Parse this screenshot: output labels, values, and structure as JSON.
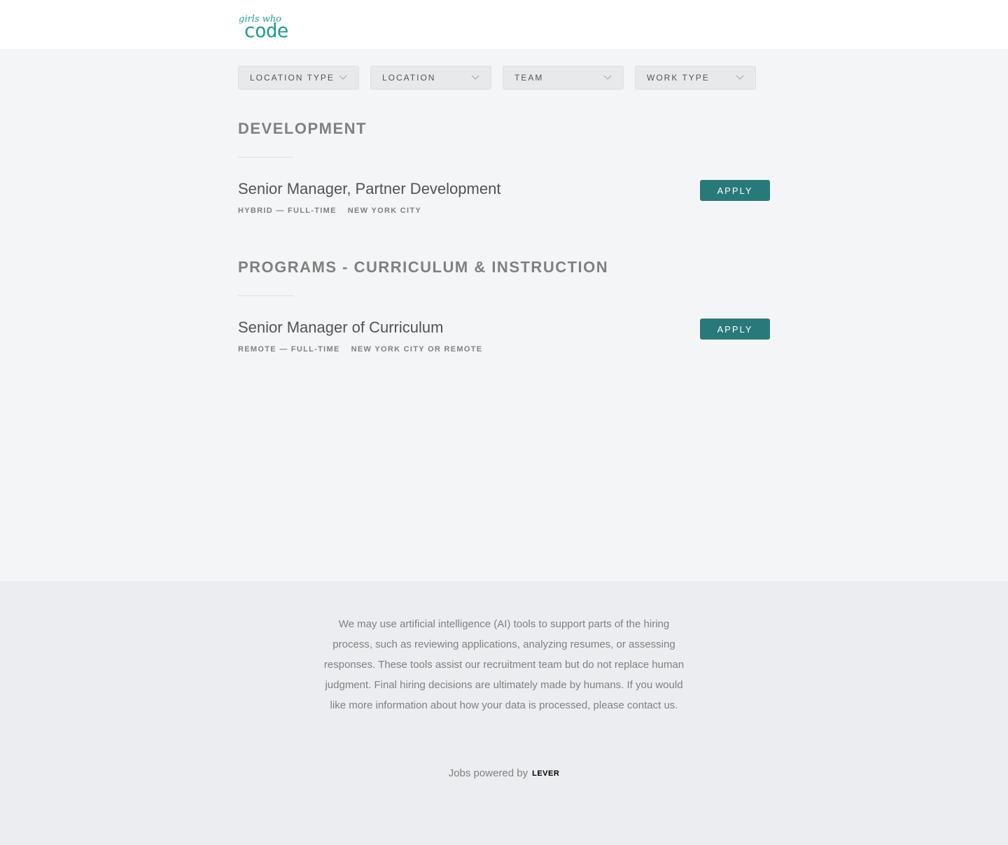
{
  "brand": {
    "logo_alt": "girls who code",
    "logo_top": "girls who",
    "logo_bottom": "code",
    "color": "#1f9e94"
  },
  "filters": [
    {
      "label": "LOCATION TYPE",
      "icon": "chevron-down-icon"
    },
    {
      "label": "LOCATION",
      "icon": "chevron-down-icon"
    },
    {
      "label": "TEAM",
      "icon": "chevron-down-icon"
    },
    {
      "label": "WORK TYPE",
      "icon": "chevron-down-icon"
    }
  ],
  "sections": [
    {
      "title": "DEVELOPMENT",
      "postings": [
        {
          "title": "Senior Manager, Partner Development",
          "commitment": "HYBRID — FULL-TIME",
          "location": "NEW YORK CITY",
          "apply_label": "APPLY"
        }
      ]
    },
    {
      "title": "PROGRAMS - CURRICULUM & INSTRUCTION",
      "postings": [
        {
          "title": "Senior Manager of Curriculum",
          "commitment": "REMOTE — FULL-TIME",
          "location": "NEW YORK CITY OR REMOTE",
          "apply_label": "APPLY"
        }
      ]
    }
  ],
  "footer": {
    "disclaimer": "We may use artificial intelligence (AI) tools to support parts of the hiring process, such as reviewing applications, analyzing resumes, or assessing responses. These tools assist our recruitment team but do not replace human judgment. Final hiring decisions are ultimately made by humans. If you would like more information about how your data is processed, please contact us.",
    "powered_by": "Jobs powered by",
    "lever_label": "LEVER"
  },
  "colors": {
    "accent": "#28797a",
    "background": "#f4f5f6",
    "footer_bg": "#ebedf0"
  }
}
